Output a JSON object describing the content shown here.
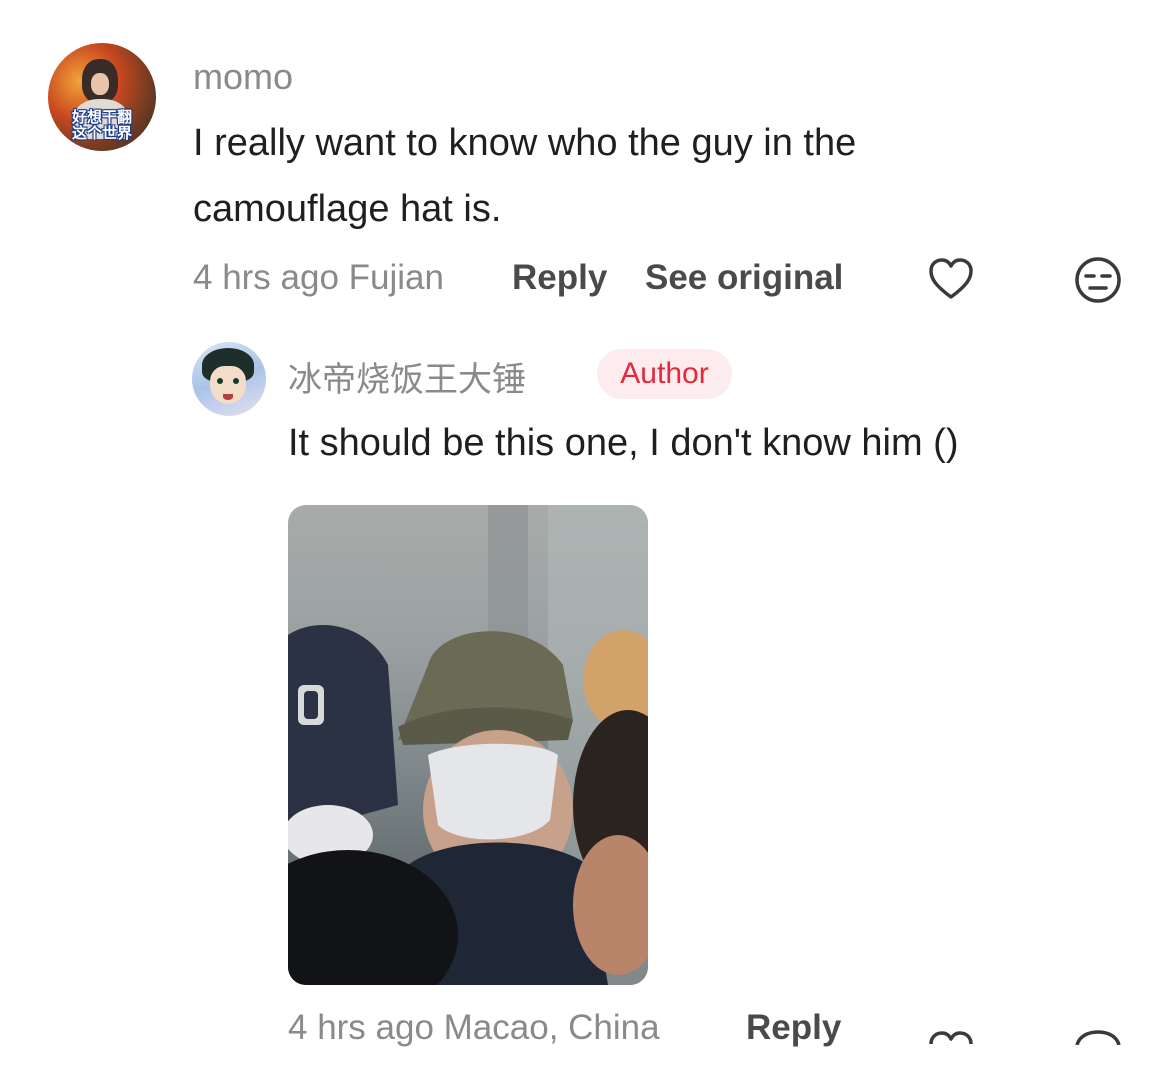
{
  "top_comment": {
    "username": "momo",
    "avatar_caption_line1": "好想干翻",
    "avatar_caption_line2": "这个世界",
    "text_line1": "I really want to know who the guy in the",
    "text_line2": "camouflage hat is.",
    "time_location": "4 hrs ago Fujian",
    "reply_label": "Reply",
    "see_original_label": "See original",
    "icons": [
      "heart-icon",
      "neutral-face-icon"
    ]
  },
  "reply_comment": {
    "username": "冰帝烧饭王大锤",
    "badge": "Author",
    "text": "It should be this one, I don't know him ()",
    "photo": {
      "description_icon": "photo-image"
    },
    "time_location": "4 hrs ago Macao, China",
    "reply_label": "Reply",
    "icons": [
      "heart-icon",
      "neutral-face-icon"
    ]
  },
  "colors": {
    "text_primary": "#1f1f1f",
    "text_secondary": "#8a8a8a",
    "link": "#4a4a4a",
    "badge_text": "#e5283c",
    "badge_bg": "#fdecee"
  }
}
